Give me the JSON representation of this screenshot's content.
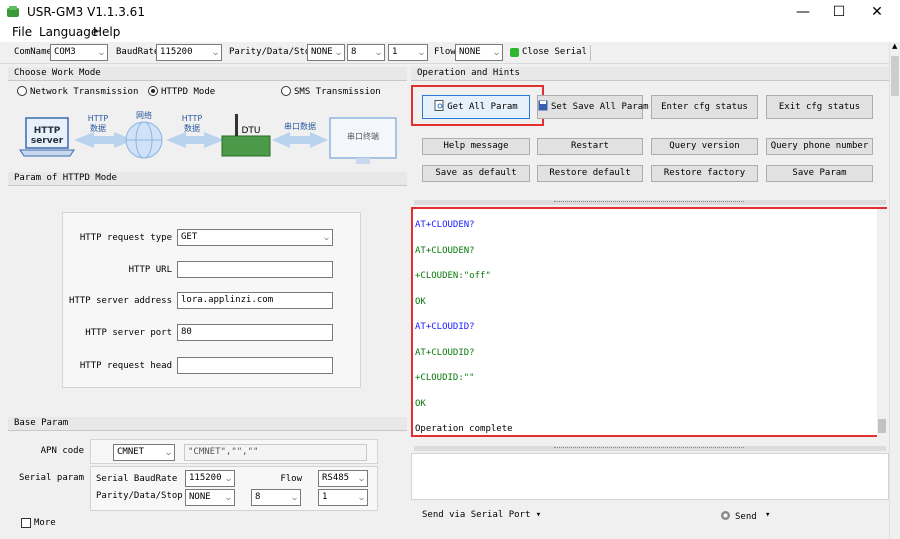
{
  "window": {
    "title": "USR-GM3 V1.1.3.61",
    "minimize": "—",
    "maximize": "☐",
    "close": "✕"
  },
  "menu": [
    "File",
    "Language",
    "Help"
  ],
  "toolbar": {
    "com_label": "ComName",
    "com_value": "COM3",
    "baud_label": "BaudRate",
    "baud_value": "115200",
    "parity_label": "Parity/Data/Stop",
    "parity_value": "NONE",
    "data_value": "8",
    "stop_value": "1",
    "flow_label": "Flow",
    "flow_value": "NONE",
    "close_serial": "Close Serial",
    "status_color": "#2fb52f"
  },
  "work_mode": {
    "header": "Choose Work Mode",
    "options": [
      "Network Transmission",
      "HTTPD Mode",
      "SMS Transmission"
    ],
    "selected": 1
  },
  "diagram": {
    "http_server": "HTTP\nserver",
    "arrow1": "HTTP\n数据",
    "network": "网络",
    "arrow2": "HTTP\n数据",
    "dtu": "DTU",
    "arrow3": "串口数据",
    "terminal": "串口终端"
  },
  "httpd": {
    "header": "Param of HTTPD Mode",
    "request_type_label": "HTTP request type",
    "request_type_value": "GET",
    "url_label": "HTTP URL",
    "url_value": "",
    "server_address_label": "HTTP server address",
    "server_address_value": "lora.applinzi.com",
    "server_port_label": "HTTP server port",
    "server_port_value": "80",
    "request_head_label": "HTTP request head",
    "request_head_value": ""
  },
  "base": {
    "header": "Base Param",
    "apn_label": "APN code",
    "apn_select": "CMNET",
    "apn_value": "\"CMNET\",\"\",\"\"",
    "serial_label": "Serial param",
    "serial_baud_label": "Serial BaudRate",
    "serial_baud_value": "115200",
    "flow_label": "Flow",
    "flow_value": "RS485",
    "pds_label": "Parity/Data/Stop",
    "parity_value": "NONE",
    "data_value": "8",
    "stop_value": "1",
    "more": "More"
  },
  "operation": {
    "header": "Operation and Hints",
    "buttons": [
      "Get All Param",
      "Set Save All Param",
      "Enter cfg status",
      "Exit cfg status",
      "Help message",
      "Restart",
      "Query version",
      "Query phone number",
      "Save as default",
      "Restore default",
      "Restore factory",
      "Save Param"
    ]
  },
  "console": {
    "lines": [
      {
        "text": "AT+CLOUDEN?",
        "color": "#1a1aff"
      },
      {
        "text": "AT+CLOUDEN?",
        "color": "#0a7a0a"
      },
      {
        "text": "+CLOUDEN:\"off\"",
        "color": "#0a7a0a"
      },
      {
        "text": "OK",
        "color": "#0a7a0a"
      },
      {
        "text": "AT+CLOUDID?",
        "color": "#1a1aff"
      },
      {
        "text": "AT+CLOUDID?",
        "color": "#0a7a0a"
      },
      {
        "text": "+CLOUDID:\"\"",
        "color": "#0a7a0a"
      },
      {
        "text": "OK",
        "color": "#0a7a0a"
      },
      {
        "text": "Operation complete",
        "color": "#000000"
      }
    ]
  },
  "send": {
    "via": "Send via Serial Port ▾",
    "send": "Send",
    "arrow": "▾"
  }
}
